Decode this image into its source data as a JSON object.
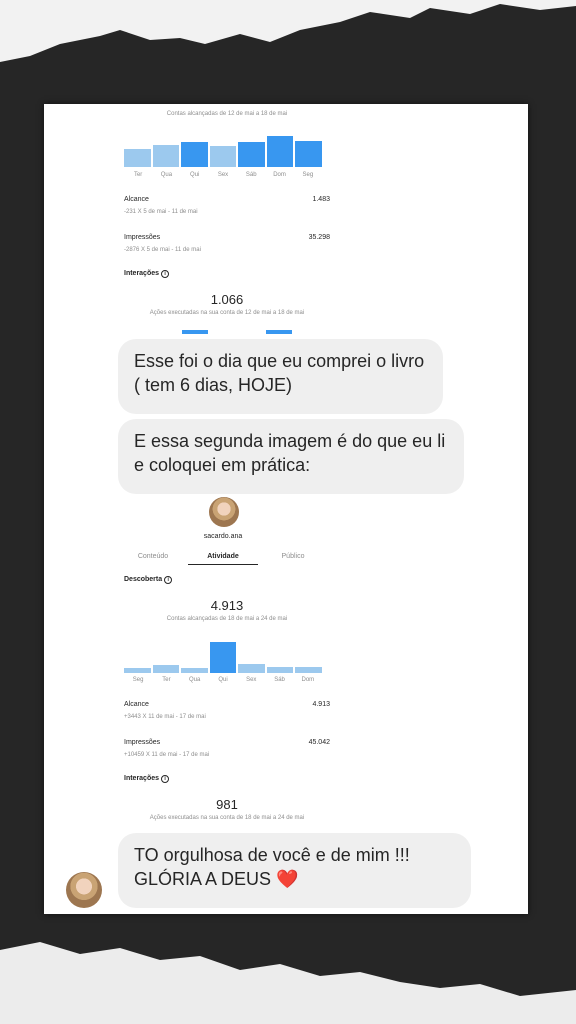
{
  "block1": {
    "reach_range": "Contas alcançadas de 12 de mai a 18 de mai",
    "chart_data": {
      "type": "bar",
      "categories": [
        "Ter",
        "Qua",
        "Qui",
        "Sex",
        "Sáb",
        "Dom",
        "Seg"
      ],
      "values": [
        20,
        25,
        28,
        23,
        28,
        35,
        29
      ],
      "ylim": [
        0,
        40
      ],
      "highlight": [
        2,
        4,
        5,
        6
      ]
    },
    "alcance_label": "Alcance",
    "alcance_value": "1.483",
    "alcance_sub": "-231 X 5 de mai - 11 de mai",
    "impressoes_label": "Impressões",
    "impressoes_value": "35.298",
    "impressoes_sub": "-2876 X 5 de mai - 11 de mai",
    "interacoes_label": "Interações",
    "interacoes_value": "1.066",
    "interacoes_sub": "Ações executadas na sua conta de 12 de mai a 18 de mai"
  },
  "messages": [
    "Esse foi o dia que eu comprei o livro ( tem 6 dias, HOJE)",
    "E essa segunda imagem é do que eu li e coloquei em prática:",
    "TO orgulhosa de você e de mim !!! GLÓRIA A DEUS ❤️"
  ],
  "profile": {
    "username": "sacardo.ana",
    "tabs": [
      "Conteúdo",
      "Atividade",
      "Público"
    ],
    "active_tab": "Atividade"
  },
  "block2": {
    "descoberta_label": "Descoberta",
    "descoberta_value": "4.913",
    "reach_range": "Contas alcançadas de 18 de mai a 24 de mai",
    "chart_data": {
      "type": "bar",
      "categories": [
        "Seg",
        "Ter",
        "Qua",
        "Qui",
        "Sex",
        "Sáb",
        "Dom"
      ],
      "values": [
        6,
        9,
        6,
        35,
        10,
        7,
        7
      ],
      "ylim": [
        0,
        40
      ],
      "highlight": [
        3
      ]
    },
    "alcance_label": "Alcance",
    "alcance_value": "4.913",
    "alcance_sub": "+3443 X 11 de mai - 17 de mai",
    "impressoes_label": "Impressões",
    "impressoes_value": "45.042",
    "impressoes_sub": "+10459 X 11 de mai - 17 de mai",
    "interacoes_label": "Interações",
    "interacoes_value": "981",
    "interacoes_sub": "Ações executadas na sua conta de 18 de mai a 24 de mai"
  },
  "colors": {
    "bar": "#9cc9ee",
    "bar_highlight": "#3897f0",
    "bubble": "#efefef"
  }
}
